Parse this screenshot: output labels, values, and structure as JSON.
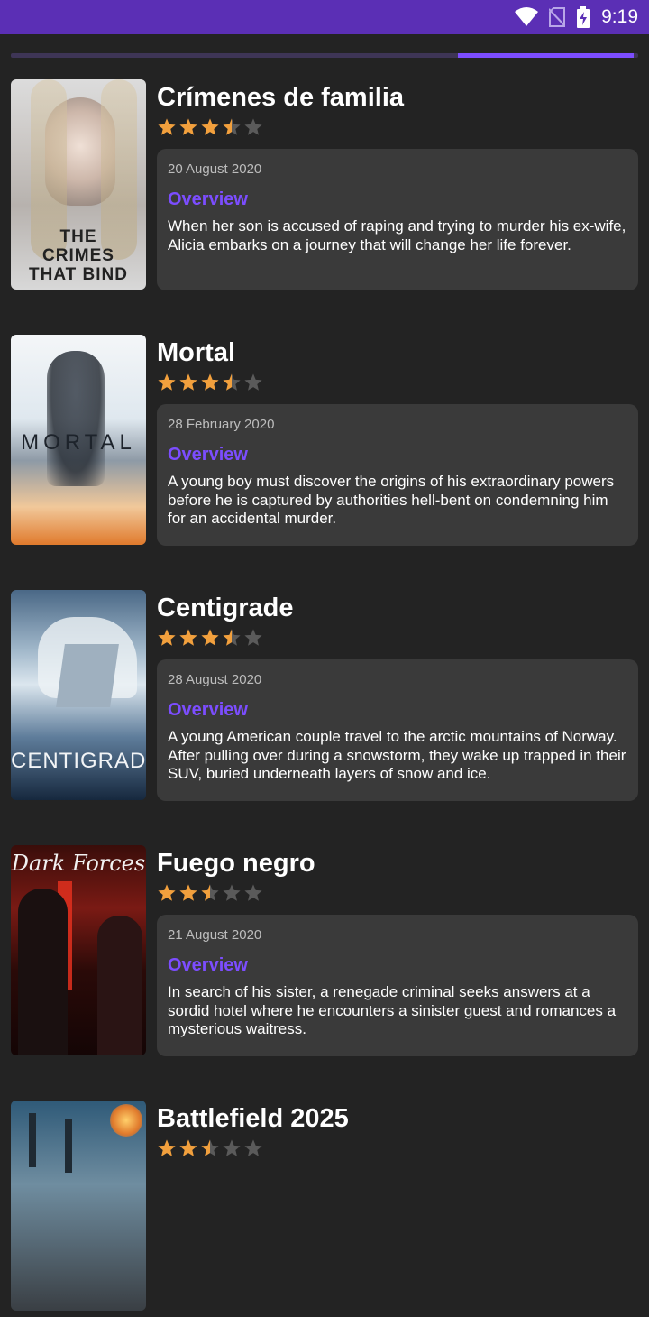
{
  "status_bar": {
    "time": "9:19",
    "background": "#5b2fb5",
    "icons": [
      "wifi-icon",
      "no-sim-icon",
      "battery-charging-icon"
    ]
  },
  "progress": {
    "start_fraction": 0.713,
    "end_fraction": 0.993,
    "color": "#7c4dff"
  },
  "overview_label": "Overview",
  "colors": {
    "star_on": "#f2a03d",
    "star_off": "#5a5a5a",
    "accent": "#7c4dff",
    "card": "#3a3a3a"
  },
  "movies": [
    {
      "title": "Crímenes de familia",
      "rating": 3.5,
      "release_date": "20 August 2020",
      "overview": "When her son is accused of raping and trying to murder his ex-wife, Alicia embarks on a journey that will change her life forever.",
      "poster_text": "THE CRIMES THAT BIND"
    },
    {
      "title": "Mortal",
      "rating": 3.5,
      "release_date": "28 February 2020",
      "overview": "A young boy must discover the origins of his extraordinary powers before he is captured by authorities hell-bent on condemning him for an accidental murder.",
      "poster_text": "MORTAL"
    },
    {
      "title": "Centigrade",
      "rating": 3.5,
      "release_date": "28 August 2020",
      "overview": "A young American couple travel to the arctic mountains of Norway. After pulling over during a snowstorm, they wake up trapped in their SUV, buried underneath layers of snow and ice.",
      "poster_text": "CENTIGRADE"
    },
    {
      "title": "Fuego negro",
      "rating": 2.5,
      "release_date": "21 August 2020",
      "overview": "In search of his sister, a renegade criminal seeks answers at a sordid hotel where he encounters a sinister guest and romances a mysterious waitress.",
      "poster_text": "Dark Forces"
    },
    {
      "title": "Battlefield 2025",
      "rating": 2.5,
      "release_date": "",
      "overview": "",
      "poster_text": ""
    }
  ]
}
